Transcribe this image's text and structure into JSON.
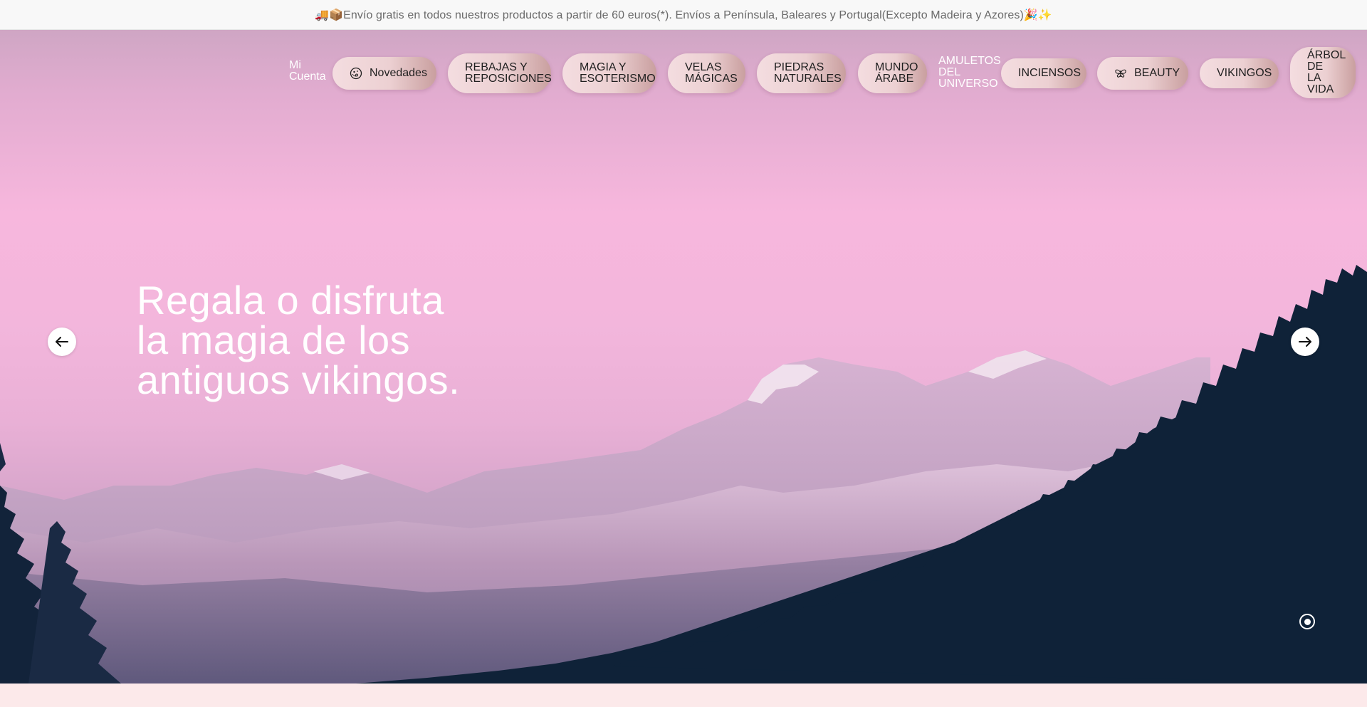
{
  "announcement": {
    "text": "🚚📦Envío gratis en todos nuestros productos a partir de 60 euros(*). Envíos a Península, Baleares y Portugal(Excepto Madeira y Azores)🎉✨"
  },
  "nav": {
    "account_line1": "Mi",
    "account_line2": "Cuenta",
    "items": [
      {
        "line1": "Novedades",
        "line2": "",
        "icon": "moon-icon"
      },
      {
        "line1": "REBAJAS Y",
        "line2": "REPOSICIONES"
      },
      {
        "line1": "MAGIA Y",
        "line2": "ESOTERISMO"
      },
      {
        "line1": "VELAS",
        "line2": "MÁGICAS"
      },
      {
        "line1": "PIEDRAS",
        "line2": "NATURALES"
      },
      {
        "line1": "MUNDO",
        "line2": "ÁRABE"
      },
      {
        "line1": "AMULETOS",
        "line2": "DEL",
        "line3": "UNIVERSO"
      },
      {
        "line1": "INCIENSOS"
      },
      {
        "line1": "BEAUTY",
        "icon": "butterfly-icon"
      },
      {
        "line1": "VIKINGOS"
      },
      {
        "line1": "ÁRBOL",
        "line2": "DE LA",
        "line3": "VIDA"
      }
    ]
  },
  "hero": {
    "title_line1": "Regala o disfruta",
    "title_line2": "la magia de los",
    "title_line3": "antiguos vikingos."
  },
  "colors": {
    "pill_start": "#f4dde0",
    "pill_end": "#c99f9f",
    "sky": "#f7b7dd",
    "forest": "#0f2238"
  }
}
